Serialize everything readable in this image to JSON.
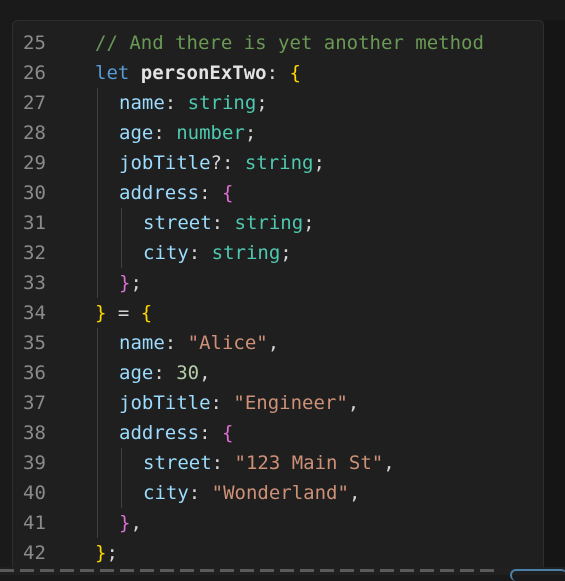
{
  "editor": {
    "lines": [
      {
        "number": "25",
        "indent": 0,
        "tokens": [
          {
            "t": "// And there is yet another method",
            "c": "comment"
          }
        ]
      },
      {
        "number": "26",
        "indent": 0,
        "tokens": [
          {
            "t": "let ",
            "c": "keyword"
          },
          {
            "t": "personExTwo",
            "c": "ident"
          },
          {
            "t": ": ",
            "c": "punct"
          },
          {
            "t": "{",
            "c": "brace1"
          }
        ]
      },
      {
        "number": "27",
        "indent": 1,
        "tokens": [
          {
            "t": "name",
            "c": "prop"
          },
          {
            "t": ": ",
            "c": "punct"
          },
          {
            "t": "string",
            "c": "type"
          },
          {
            "t": ";",
            "c": "punct"
          }
        ]
      },
      {
        "number": "28",
        "indent": 1,
        "tokens": [
          {
            "t": "age",
            "c": "prop"
          },
          {
            "t": ": ",
            "c": "punct"
          },
          {
            "t": "number",
            "c": "type"
          },
          {
            "t": ";",
            "c": "punct"
          }
        ]
      },
      {
        "number": "29",
        "indent": 1,
        "tokens": [
          {
            "t": "jobTitle",
            "c": "prop"
          },
          {
            "t": "?: ",
            "c": "punct"
          },
          {
            "t": "string",
            "c": "type"
          },
          {
            "t": ";",
            "c": "punct"
          }
        ]
      },
      {
        "number": "30",
        "indent": 1,
        "tokens": [
          {
            "t": "address",
            "c": "prop"
          },
          {
            "t": ": ",
            "c": "punct"
          },
          {
            "t": "{",
            "c": "brace2"
          }
        ]
      },
      {
        "number": "31",
        "indent": 2,
        "tokens": [
          {
            "t": "street",
            "c": "prop"
          },
          {
            "t": ": ",
            "c": "punct"
          },
          {
            "t": "string",
            "c": "type"
          },
          {
            "t": ";",
            "c": "punct"
          }
        ]
      },
      {
        "number": "32",
        "indent": 2,
        "tokens": [
          {
            "t": "city",
            "c": "prop"
          },
          {
            "t": ": ",
            "c": "punct"
          },
          {
            "t": "string",
            "c": "type"
          },
          {
            "t": ";",
            "c": "punct"
          }
        ]
      },
      {
        "number": "33",
        "indent": 1,
        "tokens": [
          {
            "t": "}",
            "c": "brace2"
          },
          {
            "t": ";",
            "c": "punct"
          }
        ]
      },
      {
        "number": "34",
        "indent": 0,
        "tokens": [
          {
            "t": "}",
            "c": "brace1"
          },
          {
            "t": " = ",
            "c": "punct"
          },
          {
            "t": "{",
            "c": "brace1"
          }
        ]
      },
      {
        "number": "35",
        "indent": 1,
        "tokens": [
          {
            "t": "name",
            "c": "prop"
          },
          {
            "t": ": ",
            "c": "punct"
          },
          {
            "t": "\"Alice\"",
            "c": "string"
          },
          {
            "t": ",",
            "c": "punct"
          }
        ]
      },
      {
        "number": "36",
        "indent": 1,
        "tokens": [
          {
            "t": "age",
            "c": "prop"
          },
          {
            "t": ": ",
            "c": "punct"
          },
          {
            "t": "30",
            "c": "number"
          },
          {
            "t": ",",
            "c": "punct"
          }
        ]
      },
      {
        "number": "37",
        "indent": 1,
        "tokens": [
          {
            "t": "jobTitle",
            "c": "prop"
          },
          {
            "t": ": ",
            "c": "punct"
          },
          {
            "t": "\"Engineer\"",
            "c": "string"
          },
          {
            "t": ",",
            "c": "punct"
          }
        ]
      },
      {
        "number": "38",
        "indent": 1,
        "tokens": [
          {
            "t": "address",
            "c": "prop"
          },
          {
            "t": ": ",
            "c": "punct"
          },
          {
            "t": "{",
            "c": "brace2"
          }
        ]
      },
      {
        "number": "39",
        "indent": 2,
        "tokens": [
          {
            "t": "street",
            "c": "prop"
          },
          {
            "t": ": ",
            "c": "punct"
          },
          {
            "t": "\"123 Main St\"",
            "c": "string"
          },
          {
            "t": ",",
            "c": "punct"
          }
        ]
      },
      {
        "number": "40",
        "indent": 2,
        "tokens": [
          {
            "t": "city",
            "c": "prop"
          },
          {
            "t": ": ",
            "c": "punct"
          },
          {
            "t": "\"Wonderland\"",
            "c": "string"
          },
          {
            "t": ",",
            "c": "punct"
          }
        ]
      },
      {
        "number": "41",
        "indent": 1,
        "tokens": [
          {
            "t": "}",
            "c": "brace2"
          },
          {
            "t": ",",
            "c": "punct"
          }
        ]
      },
      {
        "number": "42",
        "indent": 0,
        "tokens": [
          {
            "t": "}",
            "c": "brace1"
          },
          {
            "t": ";",
            "c": "punct"
          }
        ]
      }
    ]
  },
  "colors": {
    "background": "#1f1f1f",
    "comment": "#6a9955",
    "keyword": "#569cd6",
    "property": "#9cdcfe",
    "type": "#4ec9b0",
    "string": "#ce9178",
    "number": "#b5cea8",
    "bracket_level1": "#ffd700",
    "bracket_level2": "#da70d6",
    "line_number": "#8b8b8b"
  }
}
